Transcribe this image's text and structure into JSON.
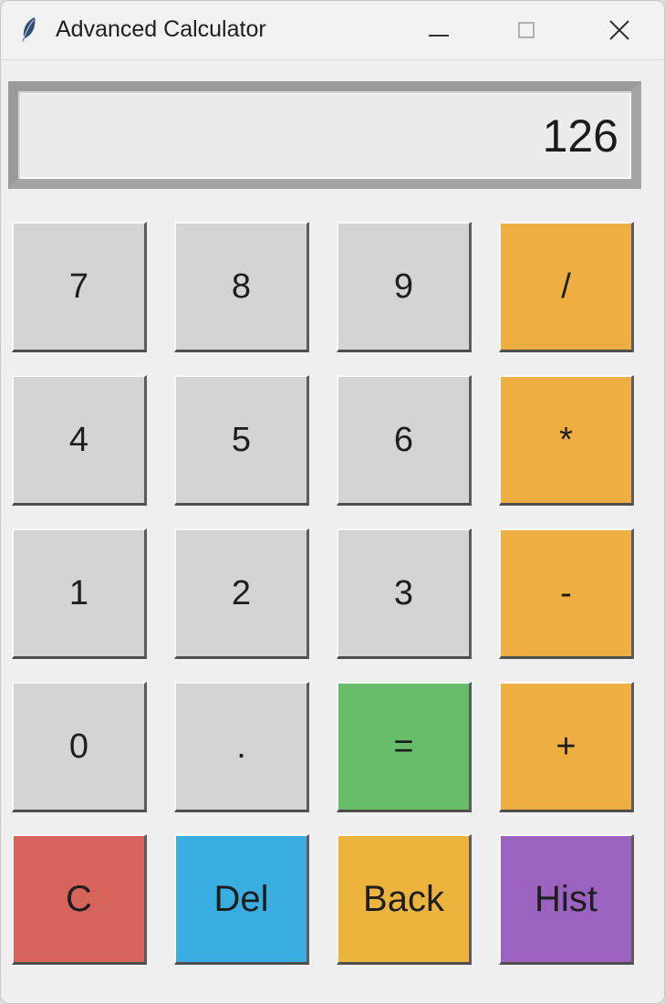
{
  "window": {
    "title": "Advanced Calculator",
    "icon": "feather-icon"
  },
  "display": {
    "value": "126"
  },
  "buttons": {
    "row1": [
      "7",
      "8",
      "9",
      "/"
    ],
    "row2": [
      "4",
      "5",
      "6",
      "*"
    ],
    "row3": [
      "1",
      "2",
      "3",
      "-"
    ],
    "row4": [
      "0",
      ".",
      "=",
      "+"
    ],
    "row5": [
      "C",
      "Del",
      "Back",
      "Hist"
    ]
  },
  "colors": {
    "digit": "#d4d4d4",
    "operator": "#efae41",
    "equals": "#68bd68",
    "clear": "#d6645a",
    "delete": "#3aaee0",
    "back": "#ecb43c",
    "history": "#9c62c0"
  }
}
